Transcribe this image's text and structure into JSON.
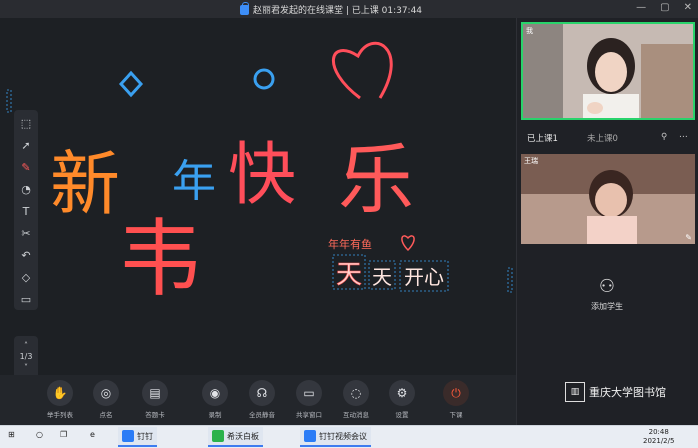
{
  "window": {
    "title": "赵丽君发起的在线课堂 | 已上课 01:37:44",
    "minimize": "—",
    "maximize": "▢",
    "close": "✕"
  },
  "board": {
    "handwriting": [
      {
        "text": "新",
        "color": "#ff8a2a"
      },
      {
        "text": "年",
        "color": "#3aa0f0"
      },
      {
        "text": "快",
        "color": "#ff4e5a"
      },
      {
        "text": "乐",
        "color": "#ff5a5a"
      },
      {
        "text": "韦",
        "color": "#ff5050"
      }
    ],
    "sticker_small": "年年有鱼",
    "sticker_chars": [
      "天",
      "天",
      "开心"
    ],
    "page_indicator": "1/3",
    "tools": [
      "select",
      "pointer",
      "pen",
      "shape",
      "text",
      "scissors",
      "undo",
      "eraser",
      "delete"
    ]
  },
  "bottom_bar": [
    {
      "icon": "hand-icon",
      "label": "举手列表"
    },
    {
      "icon": "roll-call-icon",
      "label": "点名"
    },
    {
      "icon": "answer-card-icon",
      "label": "答题卡"
    },
    {
      "icon": "record-icon",
      "label": "录制"
    },
    {
      "icon": "mute-all-icon",
      "label": "全员静音"
    },
    {
      "icon": "share-window-icon",
      "label": "共享窗口"
    },
    {
      "icon": "interaction-icon",
      "label": "互动消息"
    },
    {
      "icon": "settings-icon",
      "label": "设置"
    },
    {
      "icon": "power-icon",
      "label": "下课"
    }
  ],
  "right_panel": {
    "self_label": "我",
    "tab_active": "已上课1",
    "tab_inactive": "未上课0",
    "student_name": "王瑞",
    "add_student": "添加学生",
    "brand": "重庆大学图书馆"
  },
  "taskbar": {
    "apps": [
      {
        "label": "钉钉",
        "color": "#2b7cf6"
      },
      {
        "label": "希沃白板",
        "color": "#2bb24c"
      },
      {
        "label": "钉钉视频会议",
        "color": "#2b7cf6"
      }
    ],
    "time": "20:48",
    "date": "2021/2/5"
  },
  "colors": {
    "accent": "#29d36b",
    "end": "#ff5a3c",
    "brand_blue": "#2b7cf6"
  }
}
